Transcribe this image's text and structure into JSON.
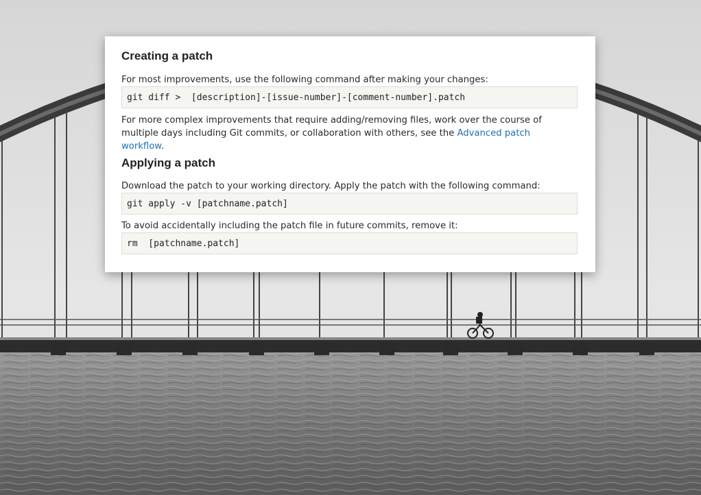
{
  "patch_doc": {
    "creating": {
      "heading": "Creating a patch",
      "intro": "For most improvements, use the following command after making your changes:",
      "command": "git diff >  [description]-[issue-number]-[comment-number].patch",
      "more_text": "For more complex improvements that require adding/removing files, work over the course of multiple days including Git commits, or collaboration with others, see the",
      "link_text": "Advanced patch workflow",
      "after_link": "."
    },
    "applying": {
      "heading": "Applying a patch",
      "intro": "Download the patch to your working directory. Apply the patch with the following command:",
      "command": "git apply -v [patchname.patch]",
      "remove_text": "To avoid accidentally including the patch file in future commits, remove it:",
      "remove_command": "rm  [patchname.patch]"
    }
  },
  "colors": {
    "link": "#1f6fb2",
    "code_bg": "#f5f5f2",
    "card_bg": "#ffffff"
  }
}
